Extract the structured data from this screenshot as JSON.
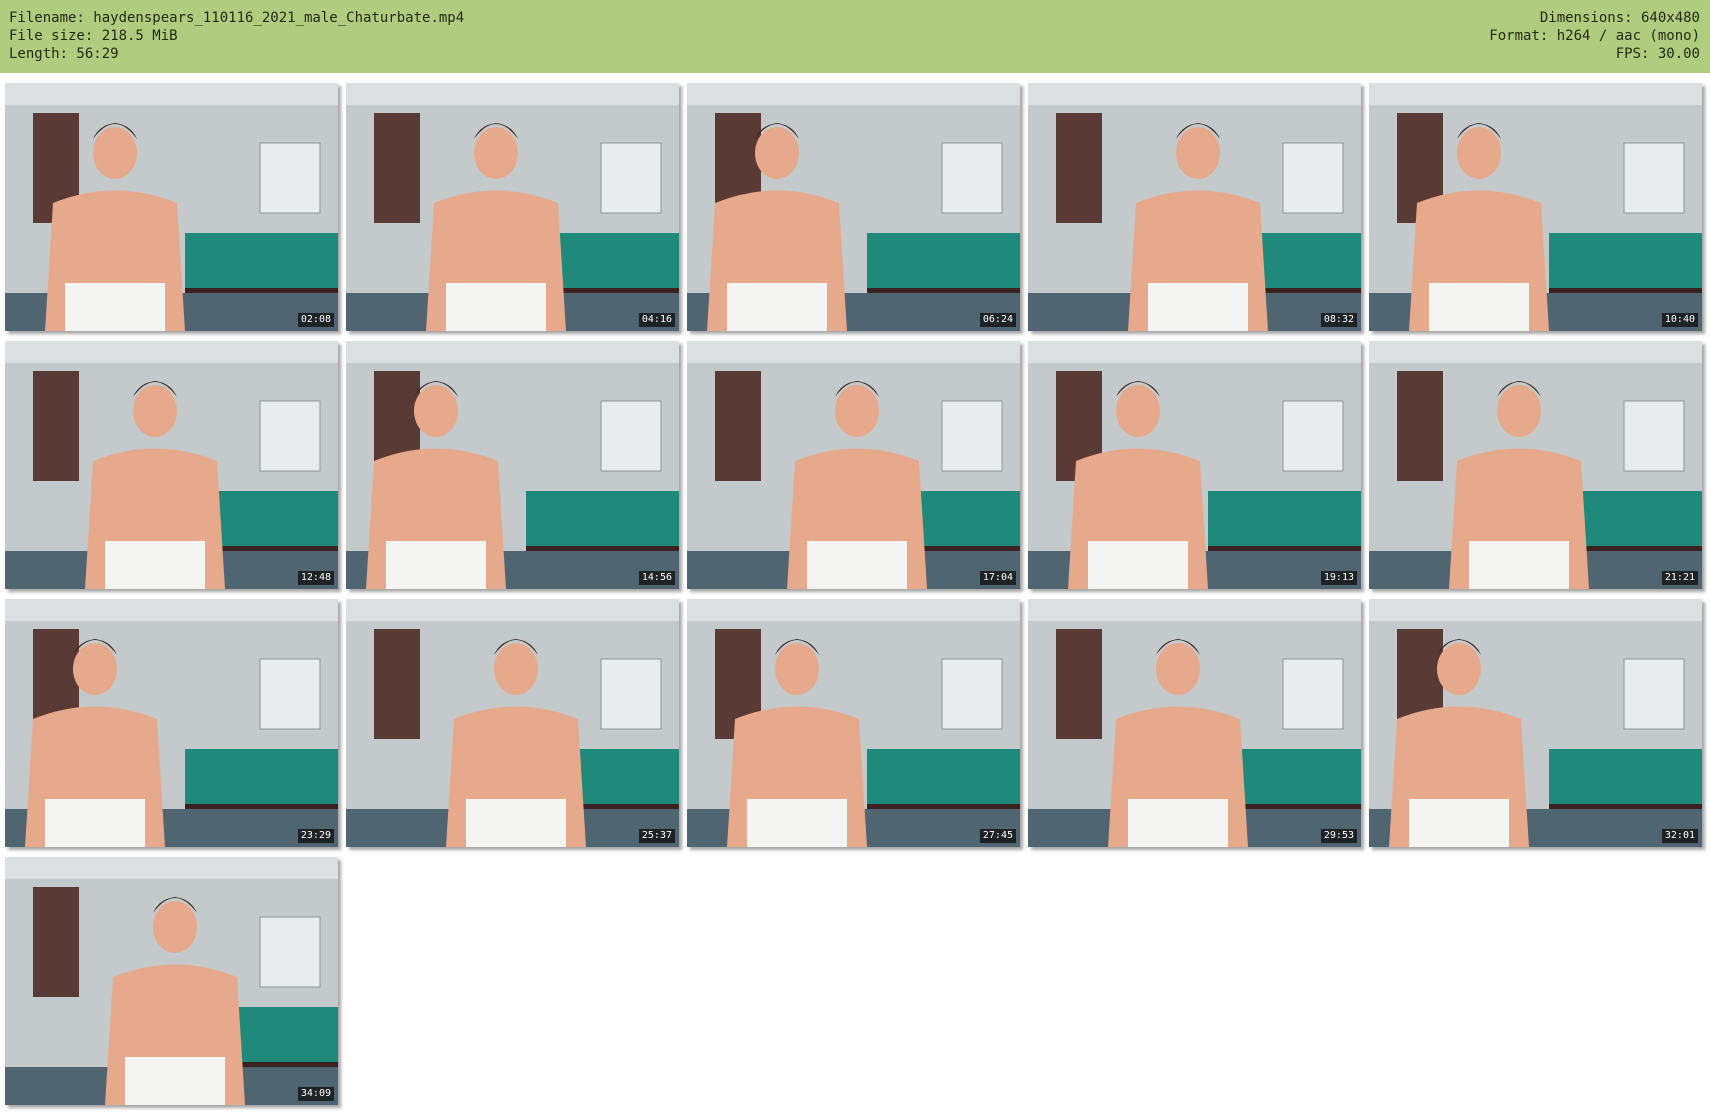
{
  "header": {
    "filename": "Filename: haydenspears_110116_2021_male_Chaturbate.mp4",
    "filesize": "File size: 218.5 MiB",
    "length": "Length: 56:29",
    "dimensions": "Dimensions: 640x480",
    "format": "Format: h264 / aac (mono)",
    "fps": "FPS: 30.00"
  },
  "thumbnails": [
    {
      "time": "02:08"
    },
    {
      "time": "04:16"
    },
    {
      "time": "06:24"
    },
    {
      "time": "08:32"
    },
    {
      "time": "10:40"
    },
    {
      "time": "12:48"
    },
    {
      "time": "14:56"
    },
    {
      "time": "17:04"
    },
    {
      "time": "19:13"
    },
    {
      "time": "21:21"
    },
    {
      "time": "23:29"
    },
    {
      "time": "25:37"
    },
    {
      "time": "27:45"
    },
    {
      "time": "29:53"
    },
    {
      "time": "32:01"
    },
    {
      "time": "34:09"
    }
  ],
  "colors": {
    "header_bg": "#b0cc7e",
    "wall": "#c4c9cc",
    "table_felt": "#1f8a7c",
    "skin": "#e7a98c",
    "underwear": "#f4f4f2",
    "door": "#5a3a34"
  }
}
